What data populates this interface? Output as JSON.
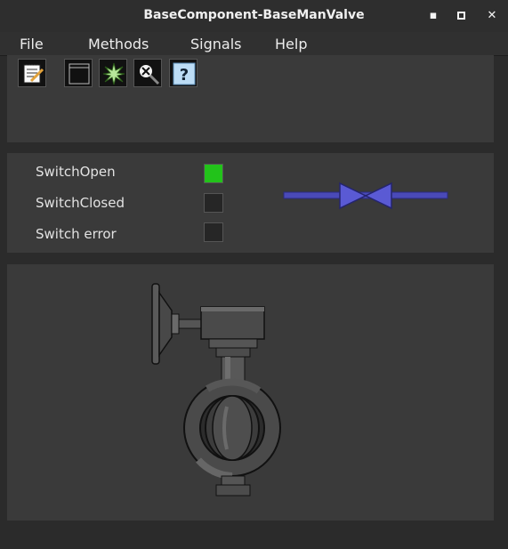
{
  "window": {
    "title": "BaseComponent-BaseManValve",
    "buttons": [
      {
        "name": "minimize",
        "glyph": "▪"
      },
      {
        "name": "maximize",
        "glyph": "□"
      },
      {
        "name": "close",
        "glyph": "✕"
      }
    ]
  },
  "menu": [
    "File",
    "Methods",
    "Signals",
    "Help"
  ],
  "toolbar": {
    "icons": [
      "notes-icon",
      "window-icon",
      "bright-star-icon",
      "zoom-x-icon",
      "help-icon"
    ]
  },
  "signals": [
    {
      "label": "SwitchOpen",
      "state": "on",
      "color": "#22c31a"
    },
    {
      "label": "SwitchClosed",
      "state": "off",
      "color": "#262626"
    },
    {
      "label": "Switch error",
      "state": "off",
      "color": "#262626"
    }
  ],
  "colors": {
    "valve_symbol": "#5b5bd0",
    "led_on": "#22c31a",
    "led_off": "#262626",
    "panel": "#3a3a3a",
    "background": "#2b2b2b"
  }
}
